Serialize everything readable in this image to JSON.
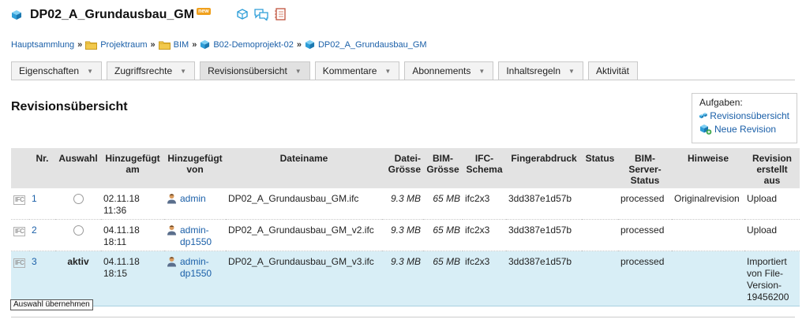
{
  "header": {
    "title": "DP02_A_Grundausbau_GM",
    "badge": "new"
  },
  "breadcrumb": [
    {
      "label": "Hauptsammlung"
    },
    {
      "label": "Projektraum"
    },
    {
      "label": "BIM"
    },
    {
      "label": "B02-Demoprojekt-02"
    },
    {
      "label": "DP02_A_Grundausbau_GM"
    }
  ],
  "tabs": [
    {
      "label": "Eigenschaften",
      "dropdown": true
    },
    {
      "label": "Zugriffsrechte",
      "dropdown": true
    },
    {
      "label": "Revisionsübersicht",
      "dropdown": true,
      "active": true
    },
    {
      "label": "Kommentare",
      "dropdown": true
    },
    {
      "label": "Abonnements",
      "dropdown": true
    },
    {
      "label": "Inhaltsregeln",
      "dropdown": true
    },
    {
      "label": "Aktivität",
      "dropdown": false
    }
  ],
  "section_title": "Revisionsübersicht",
  "tasks": {
    "title": "Aufgaben:",
    "links": [
      "Revisionsübersicht",
      "Neue Revision"
    ]
  },
  "table": {
    "headers": {
      "nr": "Nr.",
      "auswahl": "Auswahl",
      "added_at_1": "Hinzugefügt",
      "added_at_2": "am",
      "added_by_1": "Hinzugefügt",
      "added_by_2": "von",
      "filename": "Dateiname",
      "file_size_1": "Datei-",
      "file_size_2": "Grösse",
      "bim_size_1": "BIM-",
      "bim_size_2": "Grösse",
      "ifc_schema_1": "IFC-",
      "ifc_schema_2": "Schema",
      "fingerprint": "Fingerabdruck",
      "status": "Status",
      "bim_status_1": "BIM-",
      "bim_status_2": "Server-",
      "bim_status_3": "Status",
      "notes": "Hinweise",
      "created_1": "Revision",
      "created_2": "erstellt",
      "created_3": "aus"
    },
    "rows": [
      {
        "file_icon": "IFC",
        "nr": "1",
        "selection": "",
        "added_date": "02.11.18",
        "added_time": "11:36",
        "user": "admin",
        "filename": "DP02_A_Grundausbau_GM.ifc",
        "file_size": "9.3 MB",
        "bim_size": "65 MB",
        "schema": "ifc2x3",
        "fingerprint": "3dd387e1d57b",
        "status": "",
        "bim_status": "processed",
        "notes": "Originalrevision",
        "created_from": "Upload"
      },
      {
        "file_icon": "IFC",
        "nr": "2",
        "selection": "",
        "added_date": "04.11.18",
        "added_time": "18:11",
        "user": "admin-dp1550",
        "filename": "DP02_A_Grundausbau_GM_v2.ifc",
        "file_size": "9.3 MB",
        "bim_size": "65 MB",
        "schema": "ifc2x3",
        "fingerprint": "3dd387e1d57b",
        "status": "",
        "bim_status": "processed",
        "notes": "",
        "created_from": "Upload"
      },
      {
        "file_icon": "IFC",
        "nr": "3",
        "selection": "aktiv",
        "added_date": "04.11.18",
        "added_time": "18:15",
        "user": "admin-dp1550",
        "filename": "DP02_A_Grundausbau_GM_v3.ifc",
        "file_size": "9.3 MB",
        "bim_size": "65 MB",
        "schema": "ifc2x3",
        "fingerprint": "3dd387e1d57b",
        "status": "",
        "bim_status": "processed",
        "notes": "",
        "created_from": "Importiert von File-Version-19456200"
      }
    ]
  },
  "apply_button": "Auswahl übernehmen",
  "colors": {
    "link": "#1a5fa8",
    "header_row": "#e3e3e3",
    "selected_row": "#d8eef6",
    "cube_blue": "#2e9ed8",
    "folder_yellow": "#f2c94c"
  }
}
